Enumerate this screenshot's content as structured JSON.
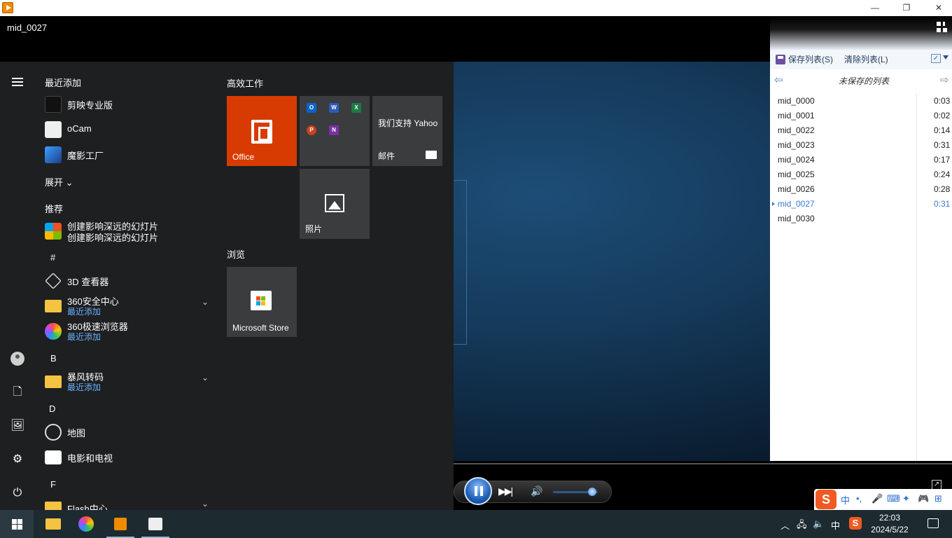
{
  "titlebar": {
    "minimize": "—",
    "restore": "❐",
    "close": "✕"
  },
  "media": {
    "current_title": "mid_0027"
  },
  "playlist": {
    "save_label": "保存列表(S)",
    "clear_label": "清除列表(L)",
    "list_title": "未保存的列表",
    "items": [
      {
        "name": "mid_0000",
        "duration": "0:03"
      },
      {
        "name": "mid_0001",
        "duration": "0:02"
      },
      {
        "name": "mid_0022",
        "duration": "0:14"
      },
      {
        "name": "mid_0023",
        "duration": "0:31"
      },
      {
        "name": "mid_0024",
        "duration": "0:17"
      },
      {
        "name": "mid_0025",
        "duration": "0:24"
      },
      {
        "name": "mid_0026",
        "duration": "0:28"
      },
      {
        "name": "mid_0027",
        "duration": "0:31"
      },
      {
        "name": "mid_0030",
        "duration": ""
      }
    ],
    "active_index": 7
  },
  "controls": {
    "volume_fraction": 0.88,
    "state": "playing"
  },
  "ime": {
    "brand": "S",
    "items": [
      "中",
      "•,",
      "🎤",
      "⌨",
      "✦",
      "🎮",
      "⊞"
    ]
  },
  "start_menu": {
    "recent_header": "最近添加",
    "recent": [
      {
        "label": "剪映专业版",
        "icon": "capcut-icon"
      },
      {
        "label": "oCam",
        "icon": "ocam-icon"
      },
      {
        "label": "魔影工厂",
        "icon": "moying-icon"
      }
    ],
    "expand_label": "展开",
    "recommended_header": "推荐",
    "recommended_title": "创建影响深远的幻灯片",
    "recommended_sub": "创建影响深远的幻灯片",
    "letters": {
      "hash": "#",
      "b": "B",
      "d": "D",
      "f": "F"
    },
    "apps": {
      "viewer3d": "3D 查看器",
      "sec360": "360安全中心",
      "sec360_sub": "最近添加",
      "browser360": "360极速浏览器",
      "browser360_sub": "最近添加",
      "baofeng": "暴风转码",
      "baofeng_sub": "最近添加",
      "maps": "地图",
      "movies": "电影和电视",
      "flash": "Flash中心"
    },
    "tiles": {
      "group1": "高效工作",
      "office": "Office",
      "yahoo": "我们支持 Yahoo",
      "mail": "邮件",
      "photos": "照片",
      "group2": "浏览",
      "store": "Microsoft Store"
    }
  },
  "taskbar": {
    "clock_time": "22:03",
    "clock_date": "2024/5/22",
    "ime_lang": "中"
  }
}
